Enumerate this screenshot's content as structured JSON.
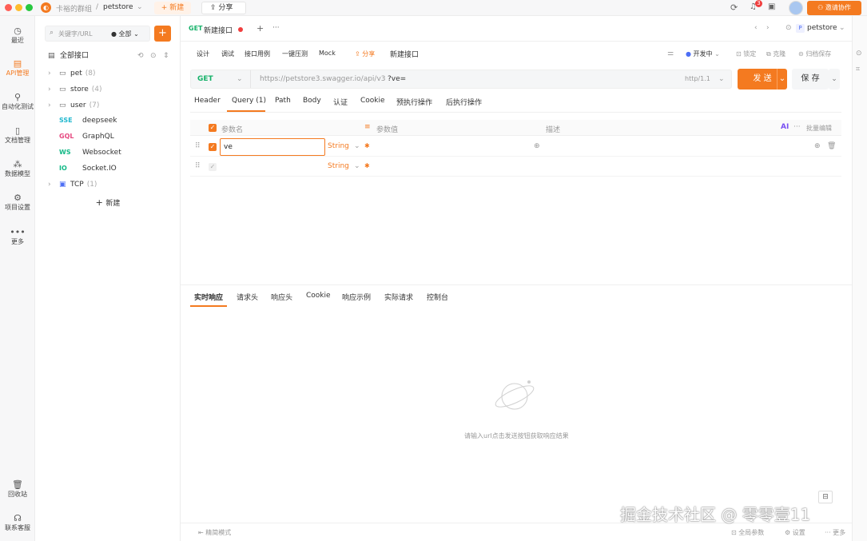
{
  "titlebar": {
    "team": "卡裕的群组",
    "separator": "/",
    "project": "petstore",
    "new_label": "+ 新建",
    "share_label": "分享",
    "notif_count": "3",
    "invite_label": "邀请协作"
  },
  "rail": {
    "items": [
      {
        "label": "最近"
      },
      {
        "label": "API管理"
      },
      {
        "label": "自动化测试"
      },
      {
        "label": "文档管理"
      },
      {
        "label": "数据模型"
      },
      {
        "label": "项目设置"
      },
      {
        "label": "更多"
      }
    ],
    "bottom": [
      {
        "label": "回收站"
      },
      {
        "label": "联系客服"
      }
    ]
  },
  "tree": {
    "search_placeholder": "关键字/URL",
    "filter_label": "全部",
    "root_label": "全部接口",
    "folders": [
      {
        "name": "pet",
        "count": "(8)"
      },
      {
        "name": "store",
        "count": "(4)"
      },
      {
        "name": "user",
        "count": "(7)"
      }
    ],
    "protocols": [
      {
        "tag": "SSE",
        "name": "deepseek",
        "color": "#22b8cf"
      },
      {
        "tag": "GQL",
        "name": "GraphQL",
        "color": "#e64980"
      },
      {
        "tag": "WS",
        "name": "Websocket",
        "color": "#12b886"
      },
      {
        "tag": "IO",
        "name": "Socket.IO",
        "color": "#12b886"
      }
    ],
    "tcp": {
      "name": "TCP",
      "count": "(1)"
    },
    "new_label": "新建"
  },
  "tabs": {
    "active_method": "GET",
    "active_name": "新建接口",
    "env_label": "petstore"
  },
  "subtabs": {
    "items": [
      "设计",
      "调试",
      "接口用例",
      "一键压测",
      "Mock"
    ],
    "share_label": "分享",
    "title": "新建接口",
    "status_label": "开发中",
    "lock_label": "锁定",
    "clone_label": "克隆",
    "archive_label": "归档保存"
  },
  "request": {
    "method": "GET",
    "url": "https://petstore3.swagger.io/api/v3",
    "query": "?ve=",
    "protocol": "http/1.1",
    "send_label": "发 送",
    "save_label": "保 存"
  },
  "param_tabs": {
    "items": [
      "Header",
      "Query (1)",
      "Path",
      "Body",
      "认证",
      "Cookie",
      "预执行操作",
      "后执行操作"
    ],
    "active": "Query (1)"
  },
  "params": {
    "col_name": "参数名",
    "col_value": "参数值",
    "col_desc": "描述",
    "ai_label": "AI",
    "bulk_label": "批量编辑",
    "rows": [
      {
        "name": "ve",
        "type": "String"
      },
      {
        "name": "",
        "type": "String"
      }
    ]
  },
  "response": {
    "tabs": [
      "实时响应",
      "请求头",
      "响应头",
      "Cookie",
      "响应示例",
      "实际请求",
      "控制台"
    ],
    "empty_text": "请输入url点击发送按钮获取响应结果"
  },
  "footer": {
    "mode_label": "精简模式",
    "global_params": "全局参数",
    "settings": "设置",
    "more": "更多"
  },
  "watermark": "掘金技术社区 @ 零零壹11",
  "colors": {
    "accent": "#f47a20",
    "get": "#17b26a"
  }
}
